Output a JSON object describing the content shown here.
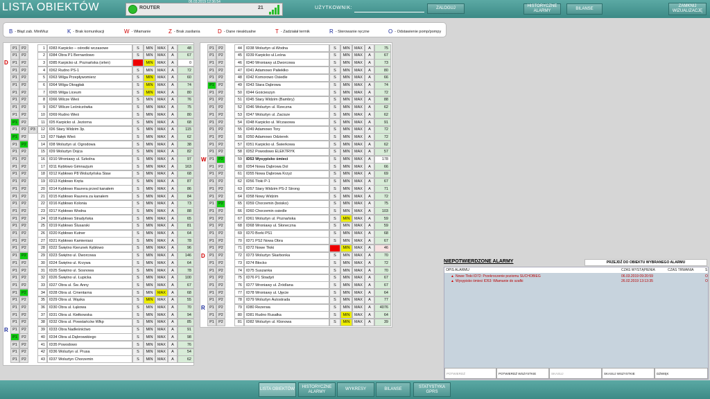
{
  "header": {
    "title": "LISTA OBIEKTÓW",
    "router_label": "ROUTER",
    "router_count": "21",
    "datetime": "06.03.2019 12:36:54",
    "user_label": "UŻYTKOWNIK:",
    "login_label": "ZALOGUJ",
    "historic_label": "HISTORYCZNE ALARMY",
    "bilanse_label": "BILANSE",
    "close_label": "ZAMKNIJ WIZUALIZACJĘ",
    "signal_level": 1.0
  },
  "legend": [
    {
      "code": "B",
      "text": "Błąd zab. MiniMuz",
      "color": "#1a2a9a"
    },
    {
      "code": "K",
      "text": "Brak komunikacji",
      "color": "#1a2a9a"
    },
    {
      "code": "W",
      "text": "Włamanie",
      "color": "#d00000"
    },
    {
      "code": "Z",
      "text": "Brak zasilania",
      "color": "#d00000"
    },
    {
      "code": "D",
      "text": "Dane nieaktualne",
      "color": "#d00000"
    },
    {
      "code": "T",
      "text": "Zadziałał termik",
      "color": "#d00000"
    },
    {
      "code": "R",
      "text": "Sterowanie ręczne",
      "color": "#1a2a9a"
    },
    {
      "code": "O",
      "text": "Odstawienie pomp/pompy",
      "color": "#1a2a9a"
    }
  ],
  "labels": {
    "p1": "P1",
    "p2": "P2",
    "p3": "P3",
    "s": "S",
    "min": "MIN",
    "max": "MAX",
    "a": "A"
  },
  "colors": {
    "pump_on": "#11cc11",
    "s_alarm": "#ee0000",
    "level_active": "#eeee00",
    "value_bg": "#d8ecd8"
  },
  "objects_left": [
    {
      "n": "1",
      "name": "ID83 Karpicko – ośrodki wczasowe",
      "value": "48"
    },
    {
      "n": "2",
      "name": "ID84 Obra P1 Bernardowo",
      "value": "67"
    },
    {
      "n": "3",
      "name": "ID85 Karpicko ul. Poznańska (orlen)",
      "value": "0",
      "code": "D",
      "code_color": "#d00000",
      "s_alarm": true,
      "level": "min",
      "valstyle": "w"
    },
    {
      "n": "4",
      "name": "ID62 Rudno PS-1",
      "value": "72"
    },
    {
      "n": "5",
      "name": "ID63 Wilga Przepływomierz",
      "value": "60",
      "level": "min"
    },
    {
      "n": "6",
      "name": "ID64 Wilga Okrągłak",
      "value": "74",
      "level": "min"
    },
    {
      "n": "7",
      "name": "ID65 Wilga Liceum",
      "value": "80",
      "level": "min"
    },
    {
      "n": "8",
      "name": "ID66 Wilcze Wieś",
      "value": "76"
    },
    {
      "n": "9",
      "name": "ID67 Wilcze Leśniczówka",
      "value": "75"
    },
    {
      "n": "10",
      "name": "ID69 Rudno Wieś",
      "value": "80"
    },
    {
      "n": "11",
      "name": "ID5 Karpicko ul. Jeziorna",
      "value": "68",
      "p1on": true
    },
    {
      "n": "12",
      "name": "ID6 Stary Widzim 3p.",
      "value": "115",
      "p3": true
    },
    {
      "n": "13",
      "name": "ID7 Nałęk Wieś",
      "value": "62",
      "p1on": true
    },
    {
      "n": "14",
      "name": "ID8 Wolsztyn ul. Ogrodowa",
      "value": "38",
      "p2on": true
    },
    {
      "n": "15",
      "name": "ID9 Wolsztyn Dojca",
      "value": "82"
    },
    {
      "n": "16",
      "name": "ID10 Wroniawy ul. Szkolna",
      "value": "97"
    },
    {
      "n": "17",
      "name": "ID11 Kębłowo Gimnazjum",
      "value": "163"
    },
    {
      "n": "18",
      "name": "ID12 Kębłowo P8 Wolsztyńska Staw",
      "value": "68"
    },
    {
      "n": "19",
      "name": "ID13 Kębłowo Kręta",
      "value": "87"
    },
    {
      "n": "20",
      "name": "ID14 Kębłowo Raurera przed kanałem",
      "value": "86"
    },
    {
      "n": "21",
      "name": "ID15 Kębłowo Raurera za kanałem",
      "value": "84"
    },
    {
      "n": "22",
      "name": "ID16 Kębłowo Kolonia",
      "value": "73"
    },
    {
      "n": "23",
      "name": "ID17 Kębłowo Wodna",
      "value": "88"
    },
    {
      "n": "24",
      "name": "ID18 Kębłowo Stradyńska",
      "value": "65"
    },
    {
      "n": "25",
      "name": "ID19 Kębłowo Ślusarski",
      "value": "81"
    },
    {
      "n": "26",
      "name": "ID20 Kębłowo Kutner",
      "value": "64"
    },
    {
      "n": "27",
      "name": "ID21 Kębłowo Kamieniarz",
      "value": "78"
    },
    {
      "n": "28",
      "name": "ID22 Świętno Kierunek Kębłowo",
      "value": "96"
    },
    {
      "n": "29",
      "name": "ID23 Świętno ul. Dworcowa",
      "value": "146",
      "p2on": true
    },
    {
      "n": "30",
      "name": "ID24 Świętno ul. Krzywa",
      "value": "64"
    },
    {
      "n": "31",
      "name": "ID25 Świętno ul. Sosnowa",
      "value": "78"
    },
    {
      "n": "32",
      "name": "ID26 Świętno ul. Łupicka",
      "value": "100"
    },
    {
      "n": "33",
      "name": "ID27 Obra ul. Św. Anny",
      "value": "67"
    },
    {
      "n": "34",
      "name": "ID28 Obra ul. Cmentarna",
      "value": "68",
      "p2on": true,
      "level": "max"
    },
    {
      "n": "35",
      "name": "ID29 Obra ul. Wąska",
      "value": "55",
      "level": "min"
    },
    {
      "n": "36",
      "name": "ID30 Obra ul. Łąkowa",
      "value": "70"
    },
    {
      "n": "37",
      "name": "ID31 Obra ul. Kiełkowska",
      "value": "94"
    },
    {
      "n": "38",
      "name": "ID32 Obra ul. Powstańców Wlkp",
      "value": "85"
    },
    {
      "n": "39",
      "name": "ID33 Obra Nadleśnictwo",
      "value": "91",
      "code": "R",
      "code_color": "#1a2a9a"
    },
    {
      "n": "40",
      "name": "ID34 Obra ul.Dąbrowskiego",
      "value": "98",
      "p1on": true
    },
    {
      "n": "41",
      "name": "ID35 Powodowo",
      "value": "76"
    },
    {
      "n": "42",
      "name": "ID36 Wolsztyn ul. Prusa",
      "value": "54"
    },
    {
      "n": "43",
      "name": "ID37 Wolsztyn Chorzemin",
      "value": "62"
    }
  ],
  "objects_right": [
    {
      "n": "44",
      "name": "ID38 Wolsztyn ul.Wodna",
      "value": "75"
    },
    {
      "n": "45",
      "name": "ID39 Karpicko ul.Leśna",
      "value": "67"
    },
    {
      "n": "46",
      "name": "ID40 Wroniawy ul.Dworcowa",
      "value": "73"
    },
    {
      "n": "47",
      "name": "ID41 Adamowo Pałiekłko",
      "value": "80"
    },
    {
      "n": "48",
      "name": "ID42 Komorowo Osiedle",
      "value": "66"
    },
    {
      "n": "49",
      "name": "ID43 Stara Dąbrowa",
      "value": "74",
      "p1on": true
    },
    {
      "n": "50",
      "name": "ID44 Gościeszyn",
      "value": "72"
    },
    {
      "n": "51",
      "name": "ID45 Stary Widzim (Bambry)",
      "value": "88"
    },
    {
      "n": "52",
      "name": "ID46 Wolsztyn ul. Rzeczna",
      "value": "62"
    },
    {
      "n": "53",
      "name": "ID47 Wolsztyn ul. Zacisze",
      "value": "62"
    },
    {
      "n": "54",
      "name": "ID48 Karpicko ul. Wczasowa",
      "value": "91"
    },
    {
      "n": "55",
      "name": "ID49 Adamowo Tory",
      "value": "72"
    },
    {
      "n": "56",
      "name": "ID50 Adamowo Odzierek",
      "value": "72"
    },
    {
      "n": "57",
      "name": "ID51 Karpicko ul. Świerkowa",
      "value": "62"
    },
    {
      "n": "58",
      "name": "ID52 Powodowo ELEKTRYK",
      "value": "57"
    },
    {
      "n": "59",
      "name": "ID53 Wysypisko śmieci",
      "value": "178",
      "code": "W",
      "code_color": "#d00000",
      "p2on": true,
      "bold": true,
      "valstyle": "w"
    },
    {
      "n": "60",
      "name": "ID54 Nowa Dąbrowa Dol",
      "value": "66"
    },
    {
      "n": "61",
      "name": "ID55 Nowa Dąbrowa Krzyż",
      "value": "69"
    },
    {
      "n": "62",
      "name": "ID56 Tłoki P-1",
      "value": "67"
    },
    {
      "n": "63",
      "name": "ID57 Stary Widzim PS-2 Strong",
      "value": "71"
    },
    {
      "n": "64",
      "name": "ID58 Nowy Widzim",
      "value": "72"
    },
    {
      "n": "65",
      "name": "ID59 Chorzemin (boisko)",
      "value": "75",
      "p2on": true
    },
    {
      "n": "66",
      "name": "ID60 Chorzemin osiedle",
      "value": "103"
    },
    {
      "n": "67",
      "name": "ID61 Wolsztyn ul. Poznańska",
      "value": "59",
      "level": "min"
    },
    {
      "n": "68",
      "name": "ID68 Wroniawy ul. Słoneczna",
      "value": "59"
    },
    {
      "n": "69",
      "name": "ID70 Borki PS1",
      "value": "68"
    },
    {
      "n": "70",
      "name": "ID71 PS2 Nowa Obra",
      "value": "67"
    },
    {
      "n": "71",
      "name": "ID72 Nowe Tłoki",
      "value": "46",
      "s_alarm": true,
      "level": "min",
      "valstyle": "p"
    },
    {
      "n": "72",
      "name": "ID73 Wolsztyn Skarbonka",
      "value": "70",
      "code": "D",
      "code_color": "#d00000"
    },
    {
      "n": "73",
      "name": "ID74 Błocko",
      "value": "72"
    },
    {
      "n": "74",
      "name": "ID75 Suszanka",
      "value": "70"
    },
    {
      "n": "75",
      "name": "ID76 P1 Stradyń",
      "value": "67"
    },
    {
      "n": "76",
      "name": "ID77 Wroniawy ul. Źródlana",
      "value": "67"
    },
    {
      "n": "77",
      "name": "ID78 Wroniawy ul. Ujęcie",
      "value": "64"
    },
    {
      "n": "78",
      "name": "ID79 Wolsztyn Autostrada",
      "value": "77"
    },
    {
      "n": "79",
      "name": "ID80 Rezerwa",
      "value": "4076",
      "code": "R",
      "code_color": "#1a2a9a"
    },
    {
      "n": "80",
      "name": "ID81 Rudno Rusałka",
      "value": "64",
      "level": "min"
    },
    {
      "n": "81",
      "name": "ID82 Wolsztyn ul. Klonowa",
      "value": "39",
      "level": "min"
    }
  ],
  "alarms": {
    "header": "NIEPOTWIERDZONE ALARMY",
    "goto_label": "PRZEJDŹ DO OBIEKTU WYBRANEGO ALARMU",
    "columns": {
      "desc": "OPIS ALARMU",
      "time": "CZAS WYSTĄPIENIA",
      "duration": "CZAS TRWANIA",
      "s": "S"
    },
    "rows": [
      {
        "desc": "Nowe Tłoki ID72: Przekroczenie poziomu SUCHOBIEG",
        "time": "06.03.2019 09:20:59",
        "s": "O"
      },
      {
        "desc": "Wysypisko śmieci ID53: Włamanie do szafki",
        "time": "26.02.2019 13:13:35",
        "s": "O"
      }
    ],
    "buttons": [
      "POTWIERDŹ",
      "POTWIERDŹ WSZYSTKIE",
      "SKASUJ",
      "SKASUJ WSZYSTKIE",
      "DŹWIĘK"
    ]
  },
  "nav": [
    "LISTA OBIEKTÓW",
    "HISTORYCZNE ALARMY",
    "WYKRESY",
    "BILANSE",
    "STATYSTYKA GPRS"
  ]
}
